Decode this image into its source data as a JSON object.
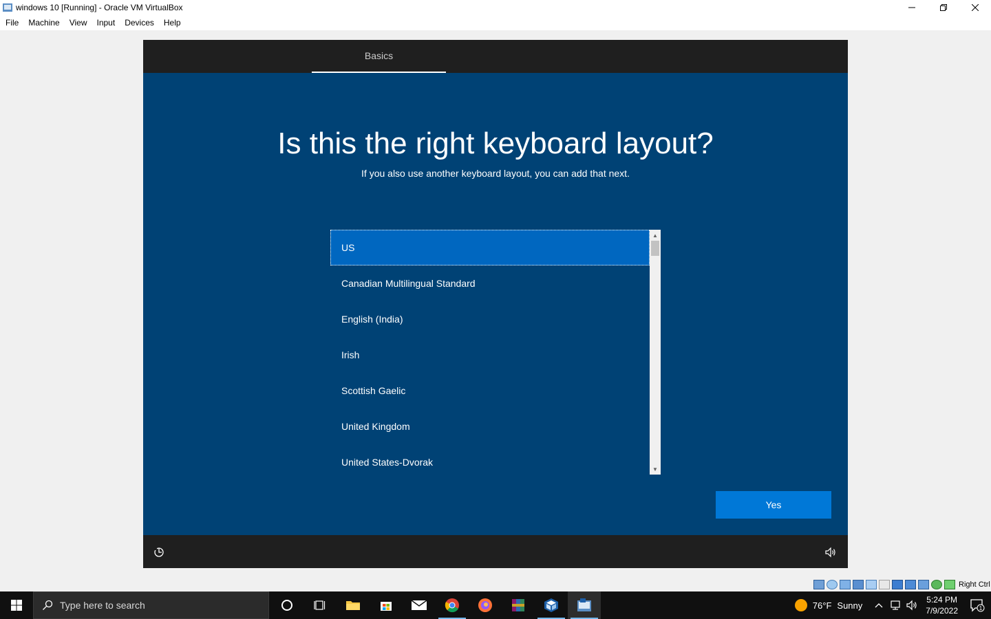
{
  "window": {
    "title": "windows 10 [Running] - Oracle VM VirtualBox"
  },
  "menu": [
    "File",
    "Machine",
    "View",
    "Input",
    "Devices",
    "Help"
  ],
  "oobe": {
    "tab": "Basics",
    "heading": "Is this the right keyboard layout?",
    "subheading": "If you also use another keyboard layout, you can add that next.",
    "layouts": [
      "US",
      "Canadian Multilingual Standard",
      "English (India)",
      "Irish",
      "Scottish Gaelic",
      "United Kingdom",
      "United States-Dvorak"
    ],
    "selected_index": 0,
    "yes_label": "Yes"
  },
  "vbox_status": {
    "host_key": "Right Ctrl"
  },
  "taskbar": {
    "search_placeholder": "Type here to search",
    "weather_temp": "76°F",
    "weather_desc": "Sunny",
    "time": "5:24 PM",
    "date": "7/9/2022",
    "notification_count": "1"
  },
  "colors": {
    "oobe_background": "#004275",
    "selected_item": "#0067c0",
    "yes_button": "#0078d7",
    "taskbar": "#101010"
  }
}
